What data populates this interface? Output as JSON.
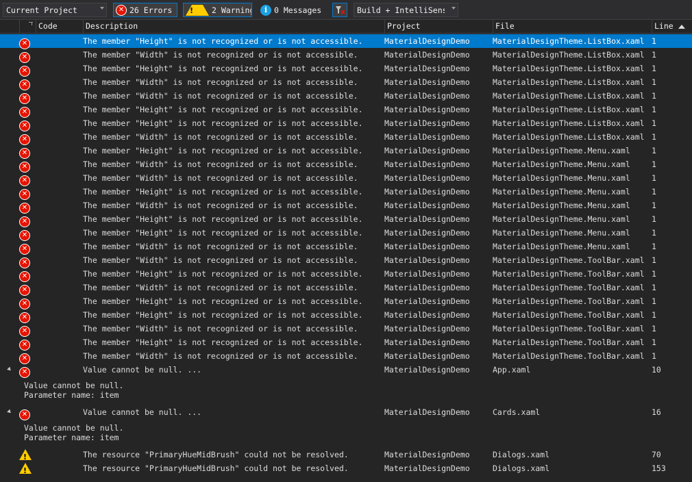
{
  "toolbar": {
    "scope": "Current Project",
    "errors_label": "26 Errors",
    "warnings_label": "2 Warnings",
    "messages_label": "0 Messages",
    "build_filter": "Build + IntelliSense"
  },
  "columns": [
    "Code",
    "Description",
    "Project",
    "File",
    "Line"
  ],
  "rows": [
    {
      "kind": "error",
      "desc": "The member \"Height\" is not recognized or is not accessible.",
      "project": "MaterialDesignDemo",
      "file": "MaterialDesignTheme.ListBox.xaml",
      "line": "1"
    },
    {
      "kind": "error",
      "desc": "The member \"Width\" is not recognized or is not accessible.",
      "project": "MaterialDesignDemo",
      "file": "MaterialDesignTheme.ListBox.xaml",
      "line": "1"
    },
    {
      "kind": "error",
      "desc": "The member \"Height\" is not recognized or is not accessible.",
      "project": "MaterialDesignDemo",
      "file": "MaterialDesignTheme.ListBox.xaml",
      "line": "1"
    },
    {
      "kind": "error",
      "desc": "The member \"Width\" is not recognized or is not accessible.",
      "project": "MaterialDesignDemo",
      "file": "MaterialDesignTheme.ListBox.xaml",
      "line": "1"
    },
    {
      "kind": "error",
      "desc": "The member \"Width\" is not recognized or is not accessible.",
      "project": "MaterialDesignDemo",
      "file": "MaterialDesignTheme.ListBox.xaml",
      "line": "1"
    },
    {
      "kind": "error",
      "desc": "The member \"Height\" is not recognized or is not accessible.",
      "project": "MaterialDesignDemo",
      "file": "MaterialDesignTheme.ListBox.xaml",
      "line": "1"
    },
    {
      "kind": "error",
      "desc": "The member \"Height\" is not recognized or is not accessible.",
      "project": "MaterialDesignDemo",
      "file": "MaterialDesignTheme.ListBox.xaml",
      "line": "1"
    },
    {
      "kind": "error",
      "desc": "The member \"Width\" is not recognized or is not accessible.",
      "project": "MaterialDesignDemo",
      "file": "MaterialDesignTheme.ListBox.xaml",
      "line": "1"
    },
    {
      "kind": "error",
      "desc": "The member \"Height\" is not recognized or is not accessible.",
      "project": "MaterialDesignDemo",
      "file": "MaterialDesignTheme.Menu.xaml",
      "line": "1"
    },
    {
      "kind": "error",
      "desc": "The member \"Width\" is not recognized or is not accessible.",
      "project": "MaterialDesignDemo",
      "file": "MaterialDesignTheme.Menu.xaml",
      "line": "1"
    },
    {
      "kind": "error",
      "desc": "The member \"Width\" is not recognized or is not accessible.",
      "project": "MaterialDesignDemo",
      "file": "MaterialDesignTheme.Menu.xaml",
      "line": "1"
    },
    {
      "kind": "error",
      "desc": "The member \"Height\" is not recognized or is not accessible.",
      "project": "MaterialDesignDemo",
      "file": "MaterialDesignTheme.Menu.xaml",
      "line": "1"
    },
    {
      "kind": "error",
      "desc": "The member \"Width\" is not recognized or is not accessible.",
      "project": "MaterialDesignDemo",
      "file": "MaterialDesignTheme.Menu.xaml",
      "line": "1"
    },
    {
      "kind": "error",
      "desc": "The member \"Height\" is not recognized or is not accessible.",
      "project": "MaterialDesignDemo",
      "file": "MaterialDesignTheme.Menu.xaml",
      "line": "1"
    },
    {
      "kind": "error",
      "desc": "The member \"Height\" is not recognized or is not accessible.",
      "project": "MaterialDesignDemo",
      "file": "MaterialDesignTheme.Menu.xaml",
      "line": "1"
    },
    {
      "kind": "error",
      "desc": "The member \"Width\" is not recognized or is not accessible.",
      "project": "MaterialDesignDemo",
      "file": "MaterialDesignTheme.Menu.xaml",
      "line": "1"
    },
    {
      "kind": "error",
      "desc": "The member \"Width\" is not recognized or is not accessible.",
      "project": "MaterialDesignDemo",
      "file": "MaterialDesignTheme.ToolBar.xaml",
      "line": "1"
    },
    {
      "kind": "error",
      "desc": "The member \"Height\" is not recognized or is not accessible.",
      "project": "MaterialDesignDemo",
      "file": "MaterialDesignTheme.ToolBar.xaml",
      "line": "1"
    },
    {
      "kind": "error",
      "desc": "The member \"Width\" is not recognized or is not accessible.",
      "project": "MaterialDesignDemo",
      "file": "MaterialDesignTheme.ToolBar.xaml",
      "line": "1"
    },
    {
      "kind": "error",
      "desc": "The member \"Height\" is not recognized or is not accessible.",
      "project": "MaterialDesignDemo",
      "file": "MaterialDesignTheme.ToolBar.xaml",
      "line": "1"
    },
    {
      "kind": "error",
      "desc": "The member \"Height\" is not recognized or is not accessible.",
      "project": "MaterialDesignDemo",
      "file": "MaterialDesignTheme.ToolBar.xaml",
      "line": "1"
    },
    {
      "kind": "error",
      "desc": "The member \"Width\" is not recognized or is not accessible.",
      "project": "MaterialDesignDemo",
      "file": "MaterialDesignTheme.ToolBar.xaml",
      "line": "1"
    },
    {
      "kind": "error",
      "desc": "The member \"Height\" is not recognized or is not accessible.",
      "project": "MaterialDesignDemo",
      "file": "MaterialDesignTheme.ToolBar.xaml",
      "line": "1"
    },
    {
      "kind": "error",
      "desc": "The member \"Width\" is not recognized or is not accessible.",
      "project": "MaterialDesignDemo",
      "file": "MaterialDesignTheme.ToolBar.xaml",
      "line": "1"
    },
    {
      "kind": "error",
      "expandable": true,
      "desc": "Value cannot be null. ...",
      "project": "MaterialDesignDemo",
      "file": "App.xaml",
      "line": "10",
      "detail": [
        "Value cannot be null.",
        "Parameter name: item"
      ]
    },
    {
      "kind": "error",
      "expandable": true,
      "desc": "Value cannot be null. ...",
      "project": "MaterialDesignDemo",
      "file": "Cards.xaml",
      "line": "16",
      "detail": [
        "Value cannot be null.",
        "Parameter name: item"
      ]
    },
    {
      "kind": "warning",
      "desc": "The resource \"PrimaryHueMidBrush\" could not be resolved.",
      "project": "MaterialDesignDemo",
      "file": "Dialogs.xaml",
      "line": "70"
    },
    {
      "kind": "warning",
      "desc": "The resource \"PrimaryHueMidBrush\" could not be resolved.",
      "project": "MaterialDesignDemo",
      "file": "Dialogs.xaml",
      "line": "153"
    }
  ],
  "colors": {
    "selection": "#007acc",
    "error": "#e51400",
    "warning": "#ffcc00",
    "info": "#1ba1e2"
  }
}
